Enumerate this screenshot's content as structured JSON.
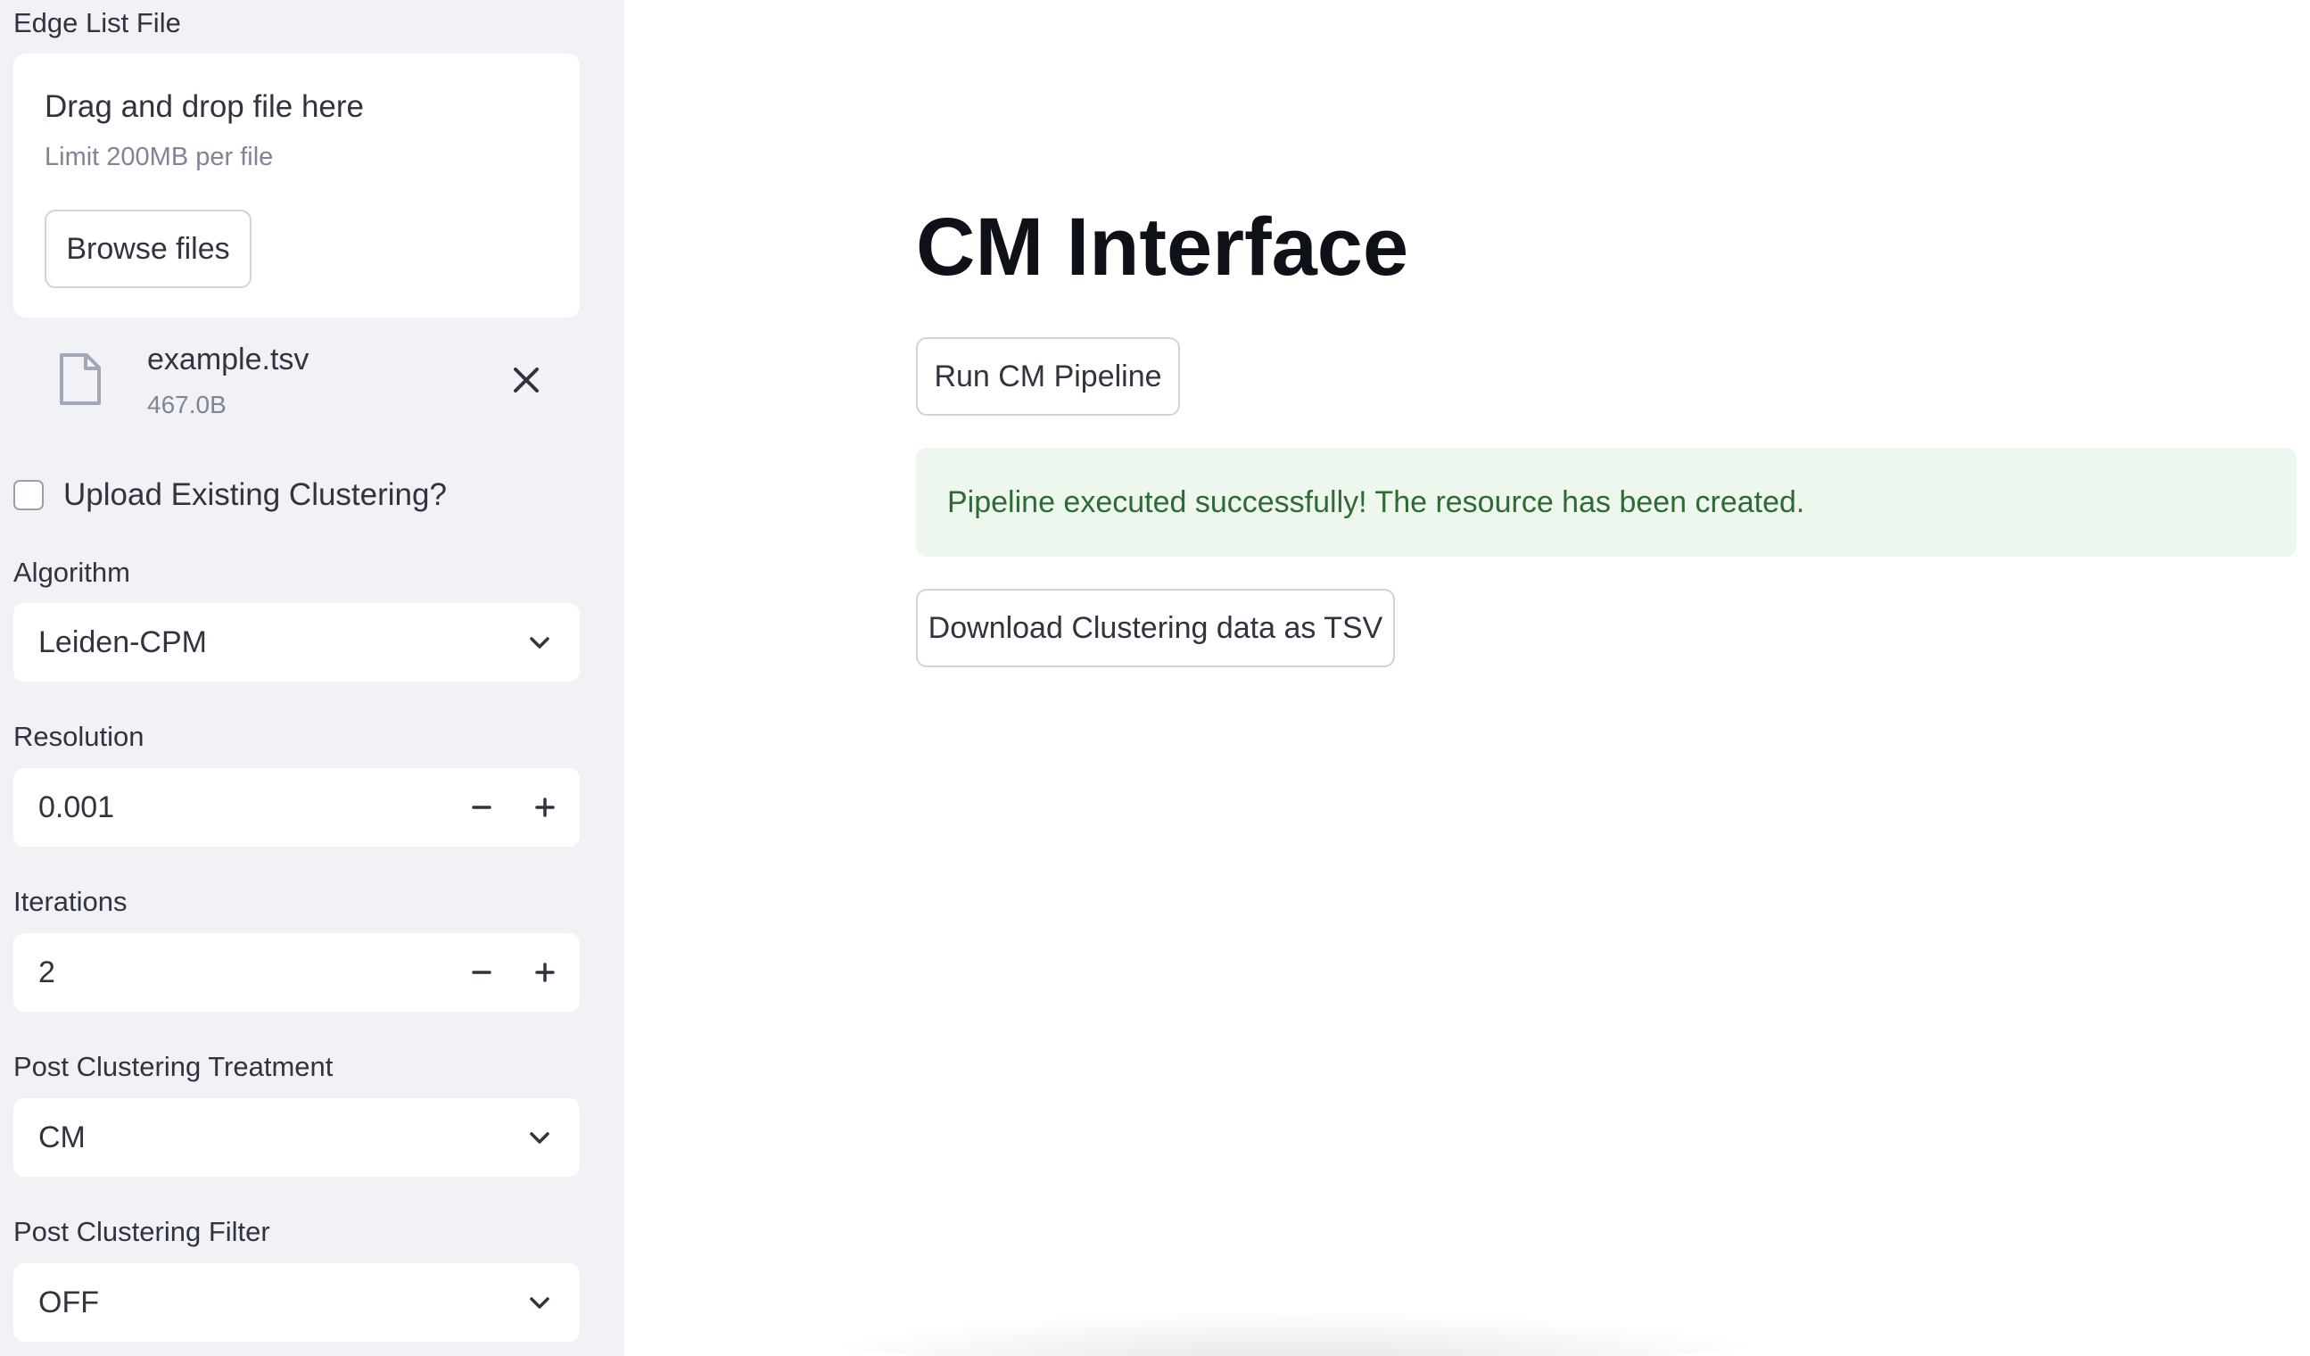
{
  "sidebar": {
    "edge_list_label": "Edge List File",
    "dropzone": {
      "title": "Drag and drop file here",
      "limit": "Limit 200MB per file",
      "browse_label": "Browse files"
    },
    "uploaded_file": {
      "name": "example.tsv",
      "size": "467.0B"
    },
    "upload_existing_label": "Upload Existing Clustering?",
    "upload_existing_checked": false,
    "algorithm": {
      "label": "Algorithm",
      "value": "Leiden-CPM"
    },
    "resolution": {
      "label": "Resolution",
      "value": "0.001"
    },
    "iterations": {
      "label": "Iterations",
      "value": "2"
    },
    "post_treatment": {
      "label": "Post Clustering Treatment",
      "value": "CM"
    },
    "post_filter": {
      "label": "Post Clustering Filter",
      "value": "OFF"
    }
  },
  "main": {
    "title": "CM Interface",
    "run_button": "Run CM Pipeline",
    "success_message": "Pipeline executed successfully! The resource has been created.",
    "download_button": "Download Clustering data as TSV"
  },
  "colors": {
    "sidebar_bg": "#f0f2f6",
    "success_bg": "#eef7ed",
    "success_text": "#2d6a34",
    "text": "#31333f"
  },
  "icons": {
    "file": "file-icon",
    "remove": "close-icon",
    "dropdown": "chevron-down-icon",
    "decrement": "minus-icon",
    "increment": "plus-icon"
  }
}
